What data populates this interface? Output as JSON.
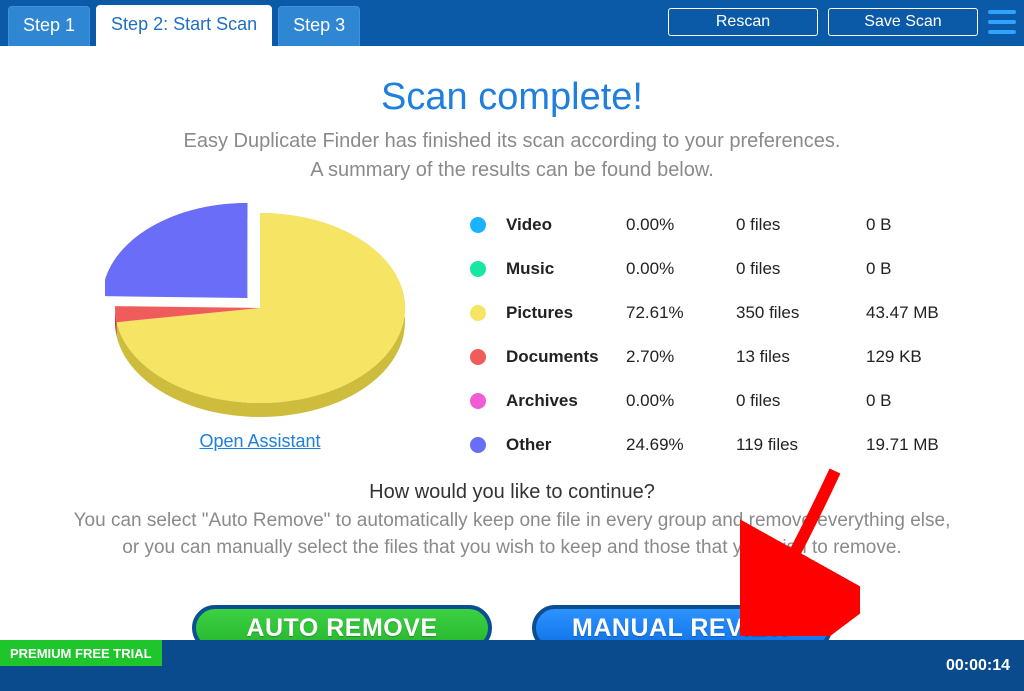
{
  "header": {
    "tabs": [
      "Step 1",
      "Step 2: Start Scan",
      "Step 3"
    ],
    "rescan": "Rescan",
    "save": "Save Scan"
  },
  "title": "Scan complete!",
  "subtitle1": "Easy Duplicate Finder has finished its scan according to your preferences.",
  "subtitle2": "A summary of the results can be found below.",
  "open_assistant": "Open Assistant",
  "chart_data": {
    "type": "pie",
    "title": "",
    "series": [
      {
        "name": "Video",
        "value": 0.0,
        "color": "#19b3ff"
      },
      {
        "name": "Music",
        "value": 0.0,
        "color": "#18e6a3"
      },
      {
        "name": "Pictures",
        "value": 72.61,
        "color": "#f6e464"
      },
      {
        "name": "Documents",
        "value": 2.7,
        "color": "#f05b5b"
      },
      {
        "name": "Archives",
        "value": 0.0,
        "color": "#ef5cd6"
      },
      {
        "name": "Other",
        "value": 24.69,
        "color": "#6a6df7"
      }
    ]
  },
  "categories": [
    {
      "label": "Video",
      "pct": "0.00%",
      "files": "0 files",
      "size": "0 B",
      "color": "#19b3ff"
    },
    {
      "label": "Music",
      "pct": "0.00%",
      "files": "0 files",
      "size": "0 B",
      "color": "#18e6a3"
    },
    {
      "label": "Pictures",
      "pct": "72.61%",
      "files": "350 files",
      "size": "43.47 MB",
      "color": "#f6e464"
    },
    {
      "label": "Documents",
      "pct": "2.70%",
      "files": "13 files",
      "size": "129 KB",
      "color": "#f05b5b"
    },
    {
      "label": "Archives",
      "pct": "0.00%",
      "files": "0 files",
      "size": "0 B",
      "color": "#ef5cd6"
    },
    {
      "label": "Other",
      "pct": "24.69%",
      "files": "119 files",
      "size": "19.71 MB",
      "color": "#6a6df7"
    }
  ],
  "continue_q": "How would you like to continue?",
  "continue_sub1": "You can select \"Auto Remove\" to automatically keep one file in every group and remove everything else,",
  "continue_sub2": "or you can manually select the files that you wish to keep and those that you wish to remove.",
  "buttons": {
    "auto": "AUTO REMOVE",
    "manual": "MANUAL REVIEW"
  },
  "footer": {
    "trial": "PREMIUM FREE TRIAL",
    "timer": "00:00:14"
  }
}
